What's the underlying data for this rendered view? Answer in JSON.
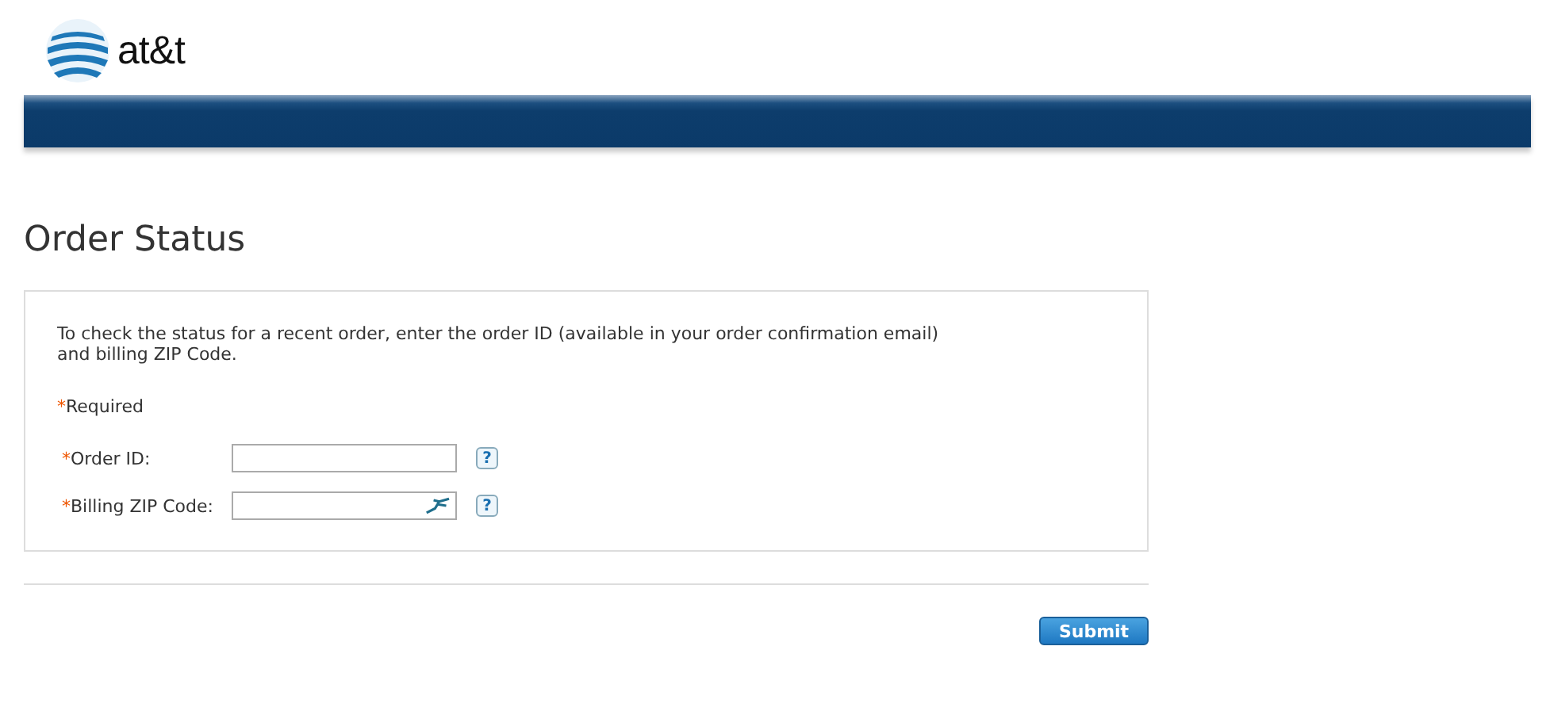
{
  "header": {
    "logo_text": "at&t"
  },
  "page_title": "Order Status",
  "form": {
    "intro": "To check the status for a recent order, enter the order ID (available in your order confirmation email)\nand billing ZIP Code.",
    "required_note": {
      "mark": "*",
      "text": "Required"
    },
    "fields": [
      {
        "mark": "*",
        "label": "Order ID:",
        "kind": "plain",
        "help": "?"
      },
      {
        "mark": "*",
        "label": "Billing ZIP Code:",
        "kind": "autofill",
        "help": "?"
      }
    ]
  },
  "buttons": [
    "Submit"
  ]
}
